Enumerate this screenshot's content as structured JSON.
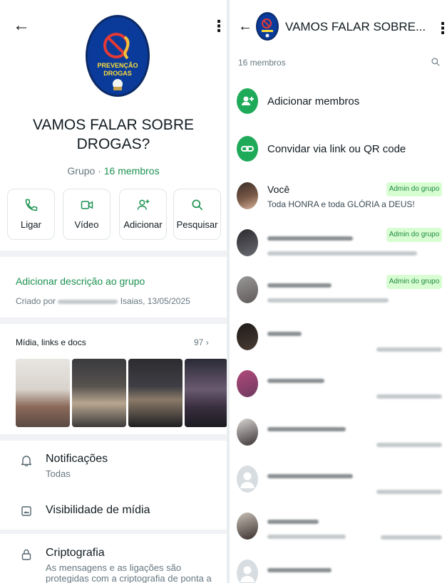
{
  "left": {
    "logo_text_1": "PREVENÇÃO",
    "logo_text_2": "DROGAS",
    "group_name_line1": "VAMOS FALAR SOBRE",
    "group_name_line2": "DROGAS?",
    "group_type": "Grupo · ",
    "member_count_label": "16 membros",
    "actions": [
      {
        "label": "Ligar",
        "icon": "phone-icon"
      },
      {
        "label": "Vídeo",
        "icon": "video-icon"
      },
      {
        "label": "Adicionar",
        "icon": "add-person-icon"
      },
      {
        "label": "Pesquisar",
        "icon": "search-icon"
      }
    ],
    "add_description": "Adicionar descrição ao grupo",
    "created_prefix": "Criado por ",
    "created_suffix": "Isaias, 13/05/2025",
    "media_header": "Mídia, links e docs",
    "media_count": "97",
    "settings": [
      {
        "title": "Notificações",
        "subtitle": "Todas",
        "icon": "bell-icon"
      },
      {
        "title": "Visibilidade de mídia",
        "subtitle": "",
        "icon": "image-icon"
      },
      {
        "title": "Criptografia",
        "subtitle": "As mensagens e as ligações são protegidas com a criptografia de ponta a",
        "icon": "lock-icon"
      }
    ]
  },
  "right": {
    "title": "VAMOS FALAR SOBRE...",
    "members_label": "16 membros",
    "add_members": "Adicionar membros",
    "invite_link": "Convidar via link ou QR code",
    "you_name": "Você",
    "you_status": "Toda HONRA e toda GLÓRIA a DEUS!",
    "admin_badge": "Admin do grupo"
  },
  "colors": {
    "brand_green": "#1faa59",
    "link_green": "#1d9151",
    "admin_badge_bg": "#d9fdd3",
    "logo_blue": "#0a3b9a"
  }
}
